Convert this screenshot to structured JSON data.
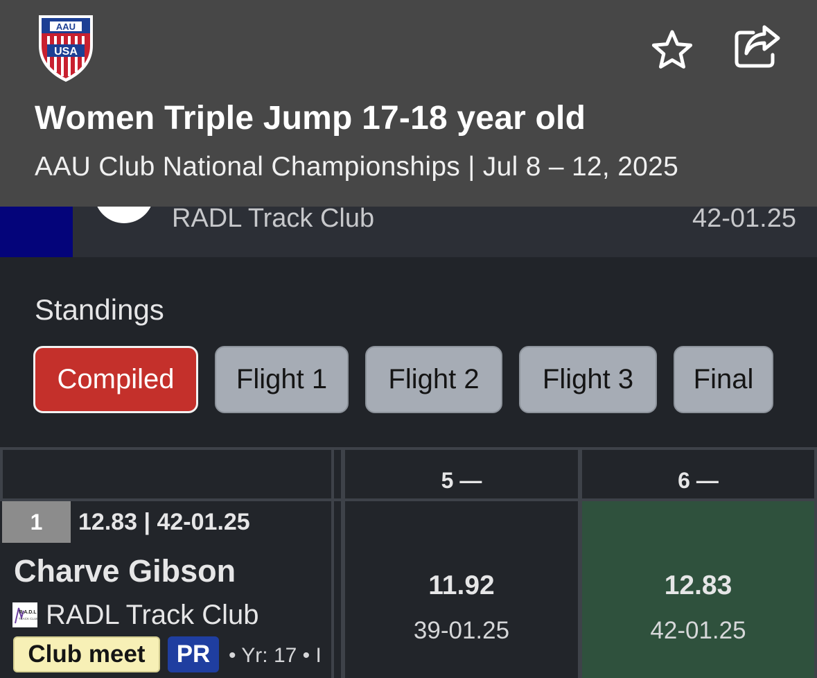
{
  "header": {
    "logo_lettering": [
      "AAU",
      "USA"
    ],
    "title": "Women Triple Jump 17-18 year old",
    "subtitle": "AAU Club National Championships | Jul 8 – 12, 2025",
    "icons": [
      "star-icon",
      "share-icon"
    ]
  },
  "strip": {
    "club": "RADL Track Club",
    "mark": "42-01.25"
  },
  "standings": {
    "label": "Standings",
    "tabs": [
      {
        "label": "Compiled",
        "active": true
      },
      {
        "label": "Flight 1",
        "active": false
      },
      {
        "label": "Flight 2",
        "active": false
      },
      {
        "label": "Flight 3",
        "active": false
      },
      {
        "label": "Final",
        "active": false
      }
    ]
  },
  "table": {
    "columns": [
      "",
      "5 —",
      "6 —"
    ],
    "row": {
      "place": "1",
      "best": "12.83 | 42-01.25",
      "athlete": "Charve Gibson",
      "club": "RADL Track Club",
      "club_logo_lettering": "R.A.D.L TRACK CLUB",
      "badge_meet": "Club meet",
      "badge_pr": "PR",
      "meta": "• Yr: 17 • I",
      "attempts": [
        {
          "metric": "11.92",
          "imperial": "39-01.25",
          "highlight": false
        },
        {
          "metric": "12.83",
          "imperial": "42-01.25",
          "highlight": true
        }
      ]
    }
  },
  "colors": {
    "header_bg": "#474747",
    "page_bg": "#212429",
    "active_tab": "#c4302b",
    "inactive_tab": "#a6acb5",
    "highlight_cell": "#2f513d",
    "pr_badge": "#1f3ea0",
    "club_badge": "#f7f0b6"
  }
}
